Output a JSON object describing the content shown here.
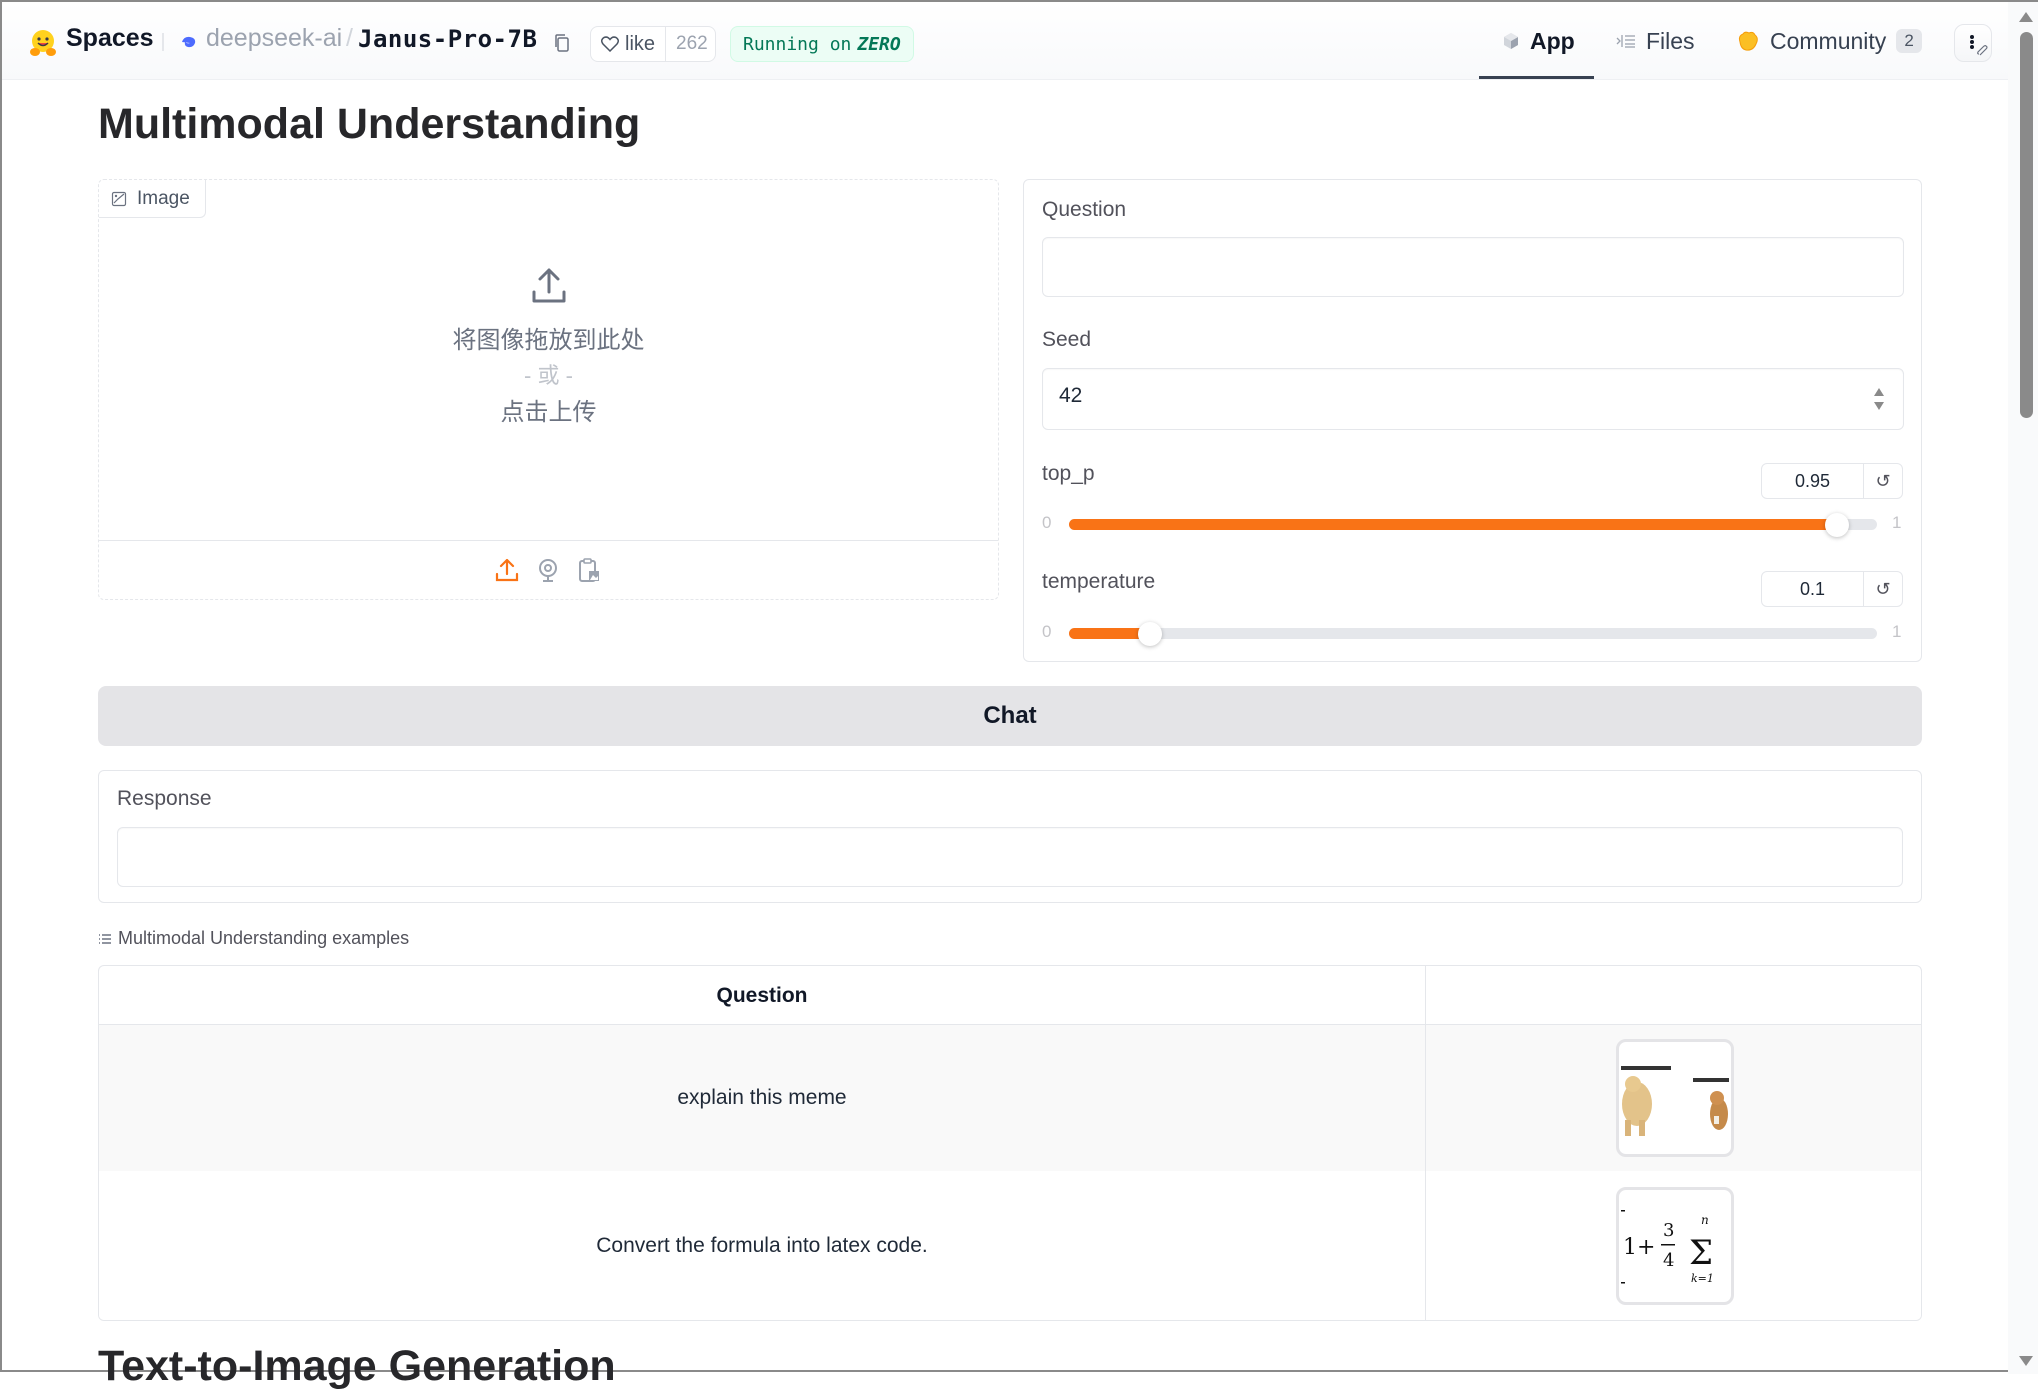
{
  "header": {
    "brand": "Spaces",
    "org": "deepseek-ai",
    "separator": "/",
    "repo": "Janus-Pro-7B",
    "like_label": "like",
    "like_count": "262",
    "running_prefix": "Running on",
    "running_hw": "ZERO",
    "tabs": [
      {
        "label": "App",
        "icon": "cube-icon",
        "active": true
      },
      {
        "label": "Files",
        "icon": "files-icon",
        "active": false
      },
      {
        "label": "Community",
        "icon": "clapping-hands-icon",
        "active": false,
        "badge": "2"
      }
    ]
  },
  "main": {
    "title": "Multimodal Understanding",
    "image_input": {
      "label": "Image",
      "drop_text": "将图像拖放到此处",
      "or_text": "- 或 -",
      "click_text": "点击上传",
      "sources": [
        "upload-icon",
        "webcam-icon",
        "clipboard-icon"
      ],
      "active_source": "upload-icon"
    },
    "question": {
      "label": "Question",
      "value": "",
      "placeholder": ""
    },
    "seed": {
      "label": "Seed",
      "value": "42"
    },
    "top_p": {
      "label": "top_p",
      "value": "0.95",
      "min": "0",
      "max": "1",
      "fraction": 0.95
    },
    "temperature": {
      "label": "temperature",
      "value": "0.1",
      "min": "0",
      "max": "1",
      "fraction": 0.1
    },
    "chat_button": "Chat",
    "response": {
      "label": "Response",
      "value": ""
    },
    "examples": {
      "label": "Multimodal Understanding examples",
      "columns": [
        "Question",
        ""
      ],
      "rows": [
        {
          "question": "explain this meme",
          "image": "doge meme thumbnail"
        },
        {
          "question": "Convert the formula into latex code.",
          "image": "formula thumbnail"
        }
      ]
    },
    "next_section_title": "Text-to-Image Generation"
  },
  "colors": {
    "accent": "#f97316",
    "button_bg": "#e4e4e7",
    "running_green": "#047857"
  }
}
